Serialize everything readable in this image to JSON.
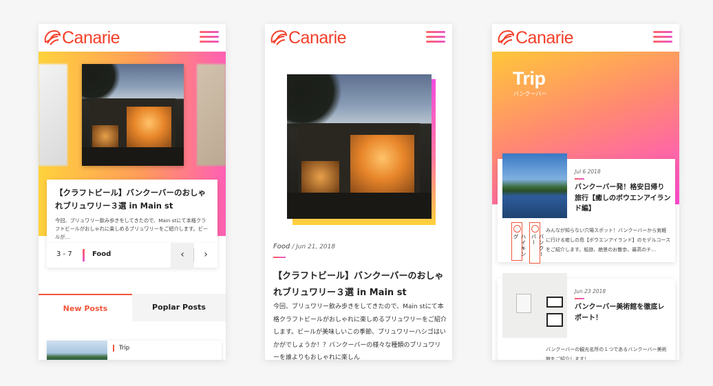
{
  "brand": {
    "name": "Canarie",
    "accent": "#f2402a"
  },
  "screen1": {
    "featured_title": "【クラフトビール】バンクーバーのおしゃれブリュワリー３選 in Main st",
    "featured_excerpt": "今回、ブリュワリー飲み歩きをしてきたので、Main stにて本格クラフトビールがおしゃれに楽しめるブリュワリーをご紹介します。ビールが…",
    "pager_count": "3 - 7",
    "pager_category": "Food",
    "prev_icon": "‹",
    "next_icon": "›",
    "tabs": [
      "New Posts",
      "Poplar Posts"
    ],
    "post_tag": "Trip"
  },
  "screen2": {
    "category": "Food",
    "date": " / Jun 21, 2018",
    "title": "【クラフトビール】バンクーバーのおしゃれブリュワリー３選 in Main st",
    "body": "今回、ブリュワリー飲み歩きをしてきたので、Main stにて本格クラフトビールがおしゃれに楽しめるブリュワリーをご紹介します。ビールが美味しいこの季節、ブリュワリーハシゴはいかがでしょうか！？バンクーバーの様々な種類のブリュワリーを誰よりもおしゃれに楽しん"
  },
  "screen3": {
    "hero_title": "Trip",
    "hero_subtitle": "バンクーバー",
    "posts": [
      {
        "date": "Jul 6 2018",
        "title": "バンクーバー発！格安日帰り旅行【癒しのボウエンアイランド編】",
        "excerpt": "みんなが知らない穴場スポット！バンクーバーから気軽に行ける癒しの島【ボウエンアイランド】のモデルコースをご紹介します。船旅、絶景のお散歩、最高のチ…",
        "tags": [
          "ハイキング",
          "バンクーバー"
        ]
      },
      {
        "date": "Jun 23 2018",
        "title": "バンクーバー美術館を徹底レポート！",
        "excerpt": "バンクーバーの観光名所の１つであるバンクーバー美術館をご紹介します！"
      }
    ]
  }
}
